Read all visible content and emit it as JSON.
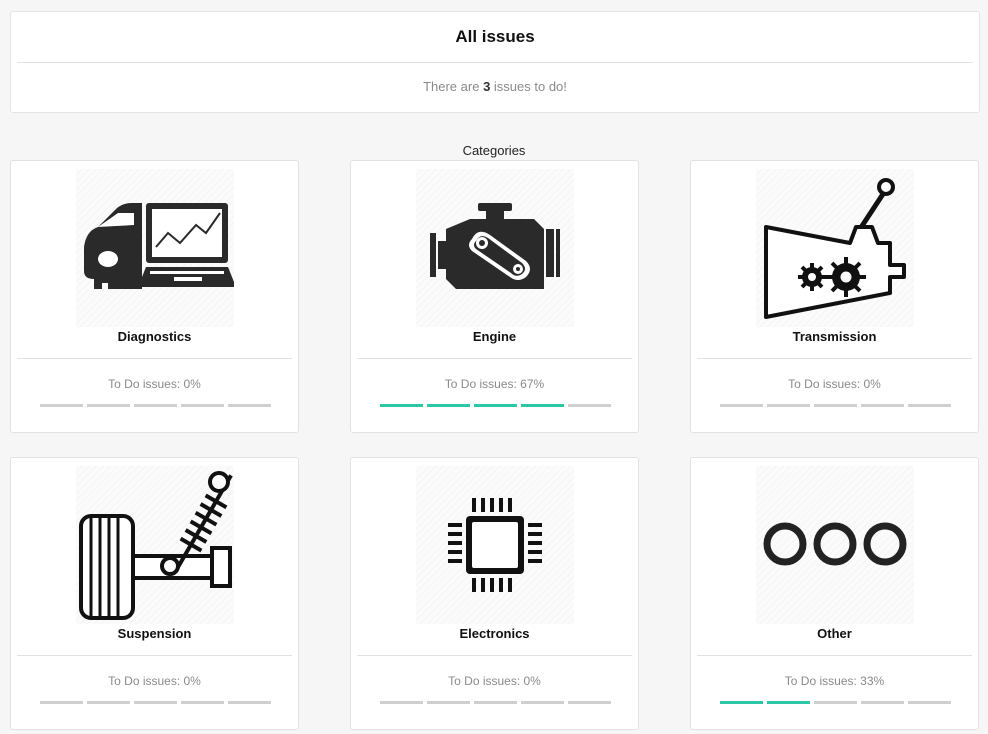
{
  "header": {
    "title": "All issues",
    "status_prefix": "There are ",
    "issue_count": "3",
    "status_suffix": " issues to do!"
  },
  "categories_heading": "Categories",
  "categories": [
    {
      "name": "Diagnostics",
      "icon": "car-laptop-icon",
      "progress_label": "To Do issues: 0%",
      "progress": 0
    },
    {
      "name": "Engine",
      "icon": "engine-icon",
      "progress_label": "To Do issues: 67%",
      "progress": 0.67
    },
    {
      "name": "Transmission",
      "icon": "gearbox-icon",
      "progress_label": "To Do issues: 0%",
      "progress": 0
    },
    {
      "name": "Suspension",
      "icon": "suspension-icon",
      "progress_label": "To Do issues: 0%",
      "progress": 0
    },
    {
      "name": "Electronics",
      "icon": "chip-icon",
      "progress_label": "To Do issues: 0%",
      "progress": 0
    },
    {
      "name": "Other",
      "icon": "rings-icon",
      "progress_label": "To Do issues: 33%",
      "progress": 0.33
    }
  ],
  "colors": {
    "progress_on": "#2cc7a6",
    "progress_off": "#cfcfcf",
    "icon": "#2a2a2a"
  }
}
